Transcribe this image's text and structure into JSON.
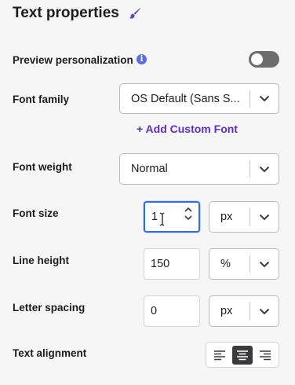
{
  "panel": {
    "title": "Text properties",
    "icon": "paintbrush-icon",
    "accent": "#6a3fd1"
  },
  "preview": {
    "label": "Preview personalization",
    "info_icon": "info-icon",
    "toggle_on": false
  },
  "font_family": {
    "label": "Font family",
    "value": "OS Default (Sans S...",
    "add_custom_label": "+ Add Custom Font"
  },
  "font_weight": {
    "label": "Font weight",
    "value": "Normal"
  },
  "font_size": {
    "label": "Font size",
    "value": "1",
    "unit": "px"
  },
  "line_height": {
    "label": "Line height",
    "value": "150",
    "unit": "%"
  },
  "letter_spacing": {
    "label": "Letter spacing",
    "value": "0",
    "unit": "px"
  },
  "text_alignment": {
    "label": "Text alignment",
    "options": [
      "align-left-icon",
      "align-center-icon",
      "align-right-icon"
    ],
    "selected": "align-center-icon"
  }
}
